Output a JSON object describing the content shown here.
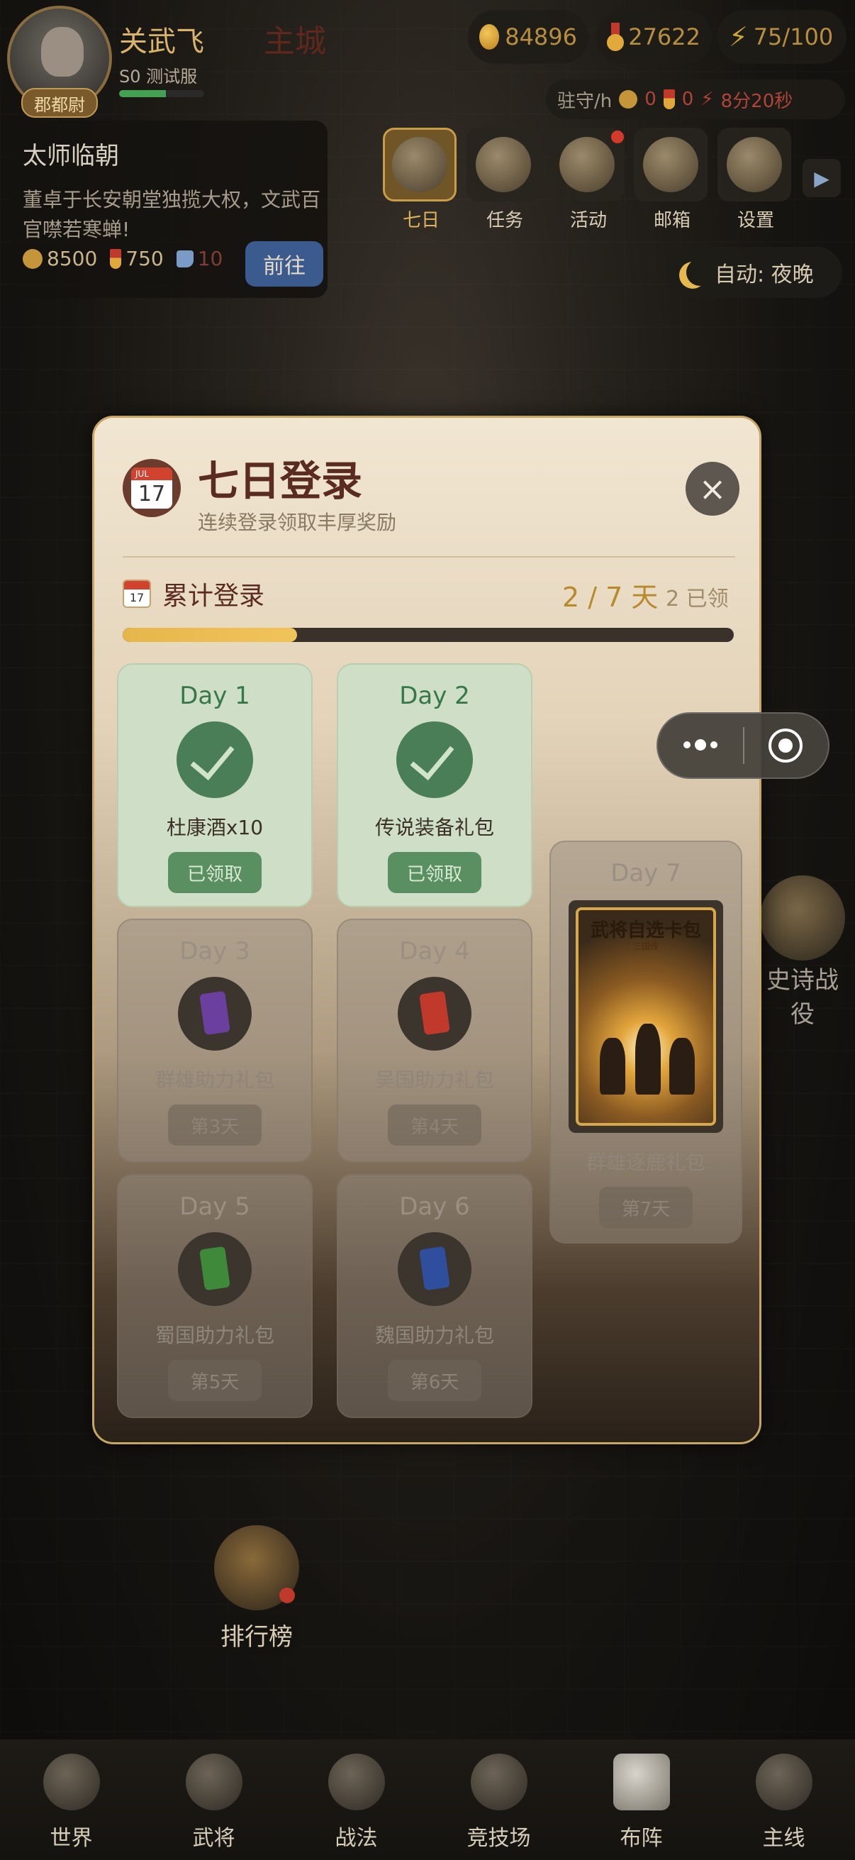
{
  "player": {
    "name": "关武飞",
    "server": "S0 测试服",
    "rank_badge": "郡都尉",
    "city": "主城",
    "exp_progress": 0.55
  },
  "resources": {
    "coins": "84896",
    "medals": "27622",
    "energy": "75/100"
  },
  "garrison": {
    "label": "驻守/h",
    "coins": "0",
    "medals": "0",
    "timer": "8分20秒"
  },
  "event": {
    "title": "太师临朝",
    "description": "董卓于长安朝堂独揽大权，文武百官噤若寒蝉!",
    "reward_coins": "8500",
    "reward_medals": "750",
    "reward_boots": "10",
    "go_label": "前往"
  },
  "menu": [
    {
      "label": "七日",
      "active": true
    },
    {
      "label": "任务"
    },
    {
      "label": "活动",
      "badge": true
    },
    {
      "label": "邮箱"
    },
    {
      "label": "设置"
    }
  ],
  "auto_mode": "自动: 夜晚",
  "modal": {
    "calendar_month": "JUL",
    "calendar_day": "17",
    "title": "七日登录",
    "subtitle": "连续登录领取丰厚奖励",
    "close_icon": "×",
    "progress_label": "累计登录",
    "progress_count": "2 / 7 天",
    "claimed": "2 已领",
    "progress_fraction": 0.2857
  },
  "days": [
    {
      "day": "Day 1",
      "item": "杜康酒x10",
      "button": "已领取",
      "status": "claimed"
    },
    {
      "day": "Day 2",
      "item": "传说装备礼包",
      "button": "已领取",
      "status": "claimed"
    },
    {
      "day": "Day 3",
      "item": "群雄助力礼包",
      "button": "第3天",
      "status": "locked",
      "color": "#6b3f9e"
    },
    {
      "day": "Day 4",
      "item": "吴国助力礼包",
      "button": "第4天",
      "status": "locked",
      "color": "#c0392b"
    },
    {
      "day": "Day 5",
      "item": "蜀国助力礼包",
      "button": "第5天",
      "status": "locked",
      "color": "#3f8a3a"
    },
    {
      "day": "Day 6",
      "item": "魏国助力礼包",
      "button": "第6天",
      "status": "locked",
      "color": "#2f4f9e"
    },
    {
      "day": "Day 7",
      "item": "群雄逐鹿礼包",
      "button": "第7天",
      "status": "locked",
      "poster_title": "武将自选卡包",
      "poster_sub": "三国传"
    }
  ],
  "epic_battle": "史诗战役",
  "leaderboard": "排行榜",
  "bottom_nav": [
    {
      "label": "世界"
    },
    {
      "label": "武将"
    },
    {
      "label": "战法"
    },
    {
      "label": "竞技场"
    },
    {
      "label": "布阵",
      "active": true
    },
    {
      "label": "主线"
    }
  ]
}
